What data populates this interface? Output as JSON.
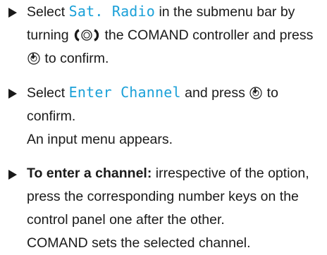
{
  "steps": [
    {
      "part1": "Select ",
      "menu_item": "Sat. Radio",
      "part2": " in the submenu bar by turning ",
      "rotate_icon": "controller-rotate-icon",
      "part3": " the COMAND controller and press ",
      "press_icon": "controller-press-icon",
      "part4": " to confirm."
    },
    {
      "part1": "Select ",
      "menu_item": "Enter Channel",
      "part2": " and press ",
      "press_icon": "controller-press-icon",
      "part3": " to confirm.",
      "result": "An input menu appears."
    },
    {
      "bold_lead": "To enter a channel:",
      "text": " irrespective of the option, press the corresponding number keys on the control panel one after the other.",
      "result": "COMAND sets the selected channel."
    }
  ],
  "colors": {
    "menu_item": "#1aa0d8",
    "text": "#1a1a1a"
  }
}
